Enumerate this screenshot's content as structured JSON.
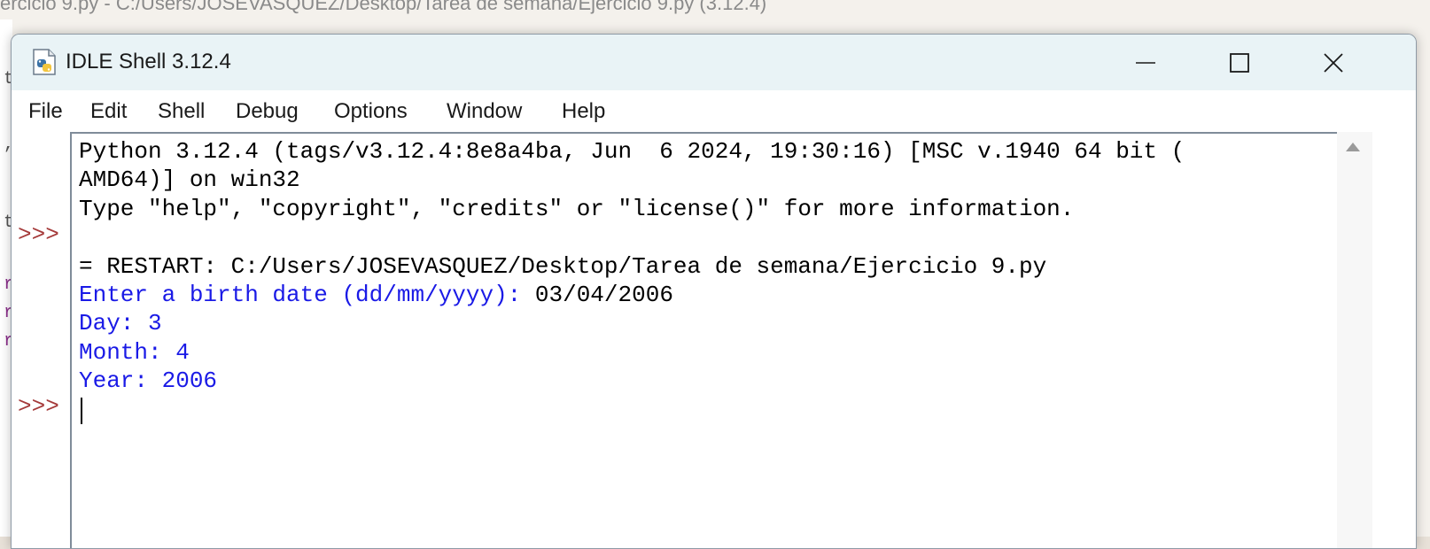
{
  "background": {
    "title": "ercicio 9.py - C:/Users/JOSEVASQUEZ/Desktop/Tarea de semana/Ejercicio 9.py (3.12.4)"
  },
  "window": {
    "title": "IDLE Shell 3.12.4",
    "icon": "python-idle-icon"
  },
  "controls": {
    "minimize": "minimize-icon",
    "maximize": "maximize-icon",
    "close": "close-icon"
  },
  "menu": {
    "items": [
      "File",
      "Edit",
      "Shell",
      "Debug",
      "Options",
      "Window",
      "Help"
    ]
  },
  "shell": {
    "prompts": [
      ">>>",
      ">>>"
    ],
    "banner_1": "Python 3.12.4 (tags/v3.12.4:8e8a4ba, Jun  6 2024, 19:30:16) [MSC v.1940 64 bit (",
    "banner_2": "AMD64)] on win32",
    "banner_3": "Type \"help\", \"copyright\", \"credits\" or \"license()\" for more information.",
    "restart": "= RESTART: C:/Users/JOSEVASQUEZ/Desktop/Tarea de semana/Ejercicio 9.py",
    "input_prompt": "Enter a birth date (dd/mm/yyyy): ",
    "input_value": "03/04/2006",
    "output_day": "Day: 3",
    "output_month": "Month: 4",
    "output_year": "Year: 2006"
  },
  "colors": {
    "stdout": "#1a1ae6",
    "prompt": "#a53a3a",
    "titlebar": "#e9f3f6"
  }
}
